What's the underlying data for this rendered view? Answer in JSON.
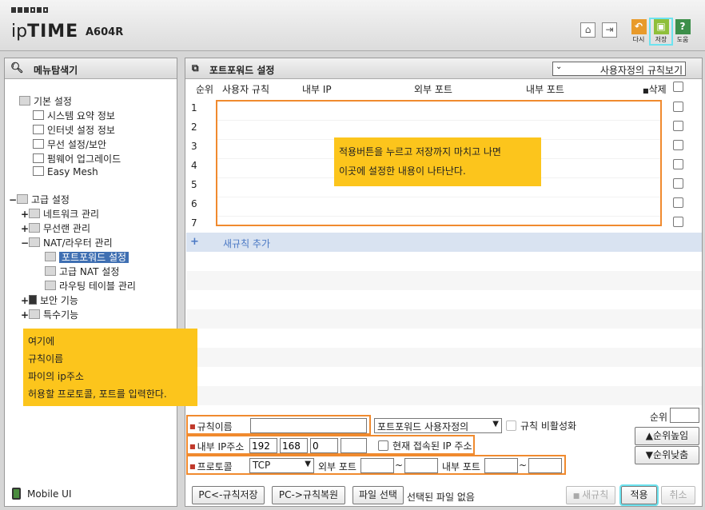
{
  "header": {
    "brand_prefix": "ip",
    "brand_bold": "TIME",
    "model": "A604R",
    "buttons": [
      {
        "label": "다시",
        "color": "#e89a2b",
        "icon": "undo-icon"
      },
      {
        "label": "저장",
        "color": "#8fbf3a",
        "icon": "save-icon"
      },
      {
        "label": "도움",
        "color": "#3c8f4a",
        "icon": "help-icon"
      }
    ],
    "help_glyph": "?"
  },
  "sidebar": {
    "title": "메뉴탐색기",
    "basic": {
      "label": "기본 설정",
      "items": [
        "시스템 요약 정보",
        "인터넷 설정 정보",
        "무선 설정/보안",
        "펌웨어 업그레이드",
        "Easy Mesh"
      ]
    },
    "advanced": {
      "label": "고급 설정",
      "items": [
        {
          "pm": "+",
          "label": "네트워크 관리"
        },
        {
          "pm": "+",
          "label": "무선랜 관리"
        },
        {
          "pm": "−",
          "label": "NAT/라우터 관리"
        }
      ],
      "nat_items": [
        "포트포워드 설정",
        "고급 NAT 설정",
        "라우팅 테이블 관리"
      ],
      "more": [
        {
          "pm": "+",
          "label": "보안 기능"
        },
        {
          "pm": "+",
          "label": "특수기능"
        }
      ],
      "pm_minus": "−"
    },
    "mobile_ui": "Mobile UI"
  },
  "main": {
    "title": "포트포워드 설정",
    "view_select": "사용자정의 규칙보기",
    "columns": {
      "num": "순위",
      "rule": "사용자 규칙",
      "internal_ip": "내부 IP",
      "external_port": "외부 포트",
      "internal_port": "내부 포트",
      "delete": "삭제"
    },
    "rows": [
      "1",
      "2",
      "3",
      "4",
      "5",
      "6",
      "7"
    ],
    "add_rule": "새규칙 추가",
    "add_plus": "+"
  },
  "notes": {
    "top": [
      "적용버튼을 누르고 저장까지 마치고 나면",
      "이곳에 설정한 내용이 나타난다."
    ],
    "left": [
      "여기에",
      "규칙이름",
      "파이의 ip주소",
      "허용할 프로토콜, 포트를 입력한다."
    ]
  },
  "form": {
    "rule_name_label": "규칙이름",
    "rule_name_value": "",
    "preset_select": "포트포워드 사용자정의",
    "disable_rule_label": "규칙 비활성화",
    "internal_ip_label": "내부 IP주소",
    "ip": [
      "192",
      "168",
      "0",
      ""
    ],
    "current_ip_label": "현재 접속된 IP 주소",
    "protocol_label": "프로토콜",
    "protocol_value": "TCP",
    "external_port_label": "외부 포트",
    "internal_port_label": "내부 포트",
    "tilde": "~",
    "rank_label": "순위",
    "rank_up": "▲순위높임",
    "rank_down": "▼순위낮춤"
  },
  "bottom": {
    "save_pc": "PC<-규칙저장",
    "restore_pc": "PC->규칙복원",
    "file_select": "파일 선택",
    "file_status": "선택된 파일 없음",
    "new_rule": "새규칙",
    "apply": "적용",
    "cancel": "취소"
  }
}
